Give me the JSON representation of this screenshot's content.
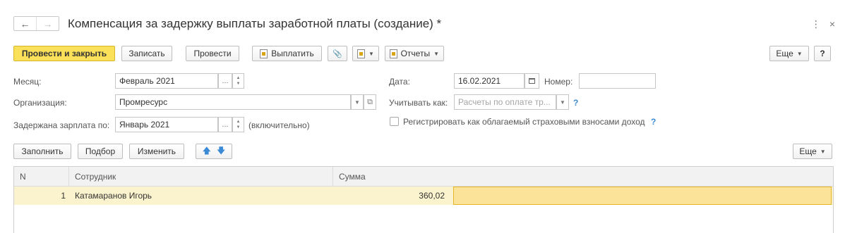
{
  "window": {
    "title": "Компенсация за задержку выплаты заработной платы (создание) *",
    "back_icon": "←",
    "forward_icon": "→",
    "more_icon": "⋮",
    "close_icon": "×"
  },
  "toolbar": {
    "post_close": "Провести и закрыть",
    "save": "Записать",
    "post": "Провести",
    "pay": "Выплатить",
    "attach_icon": "📎",
    "reports": "Отчеты",
    "more": "Еще",
    "help": "?"
  },
  "form": {
    "month_label": "Месяц:",
    "month_value": "Февраль 2021",
    "org_label": "Организация:",
    "org_value": "Промресурс",
    "delayed_label": "Задержана зарплата по:",
    "delayed_value": "Январь 2021",
    "inclusive_note": "(включительно)",
    "date_label": "Дата:",
    "date_value": "16.02.2021",
    "number_label": "Номер:",
    "number_value": "",
    "account_as_label": "Учитывать как:",
    "account_as_placeholder": "Расчеты по оплате тр...",
    "help_mark": "?",
    "register_checkbox_label": "Регистрировать как облагаемый страховыми взносами доход",
    "register_checked": false,
    "ellipsis": "...",
    "link_icon": "⧉"
  },
  "table_toolbar": {
    "fill": "Заполнить",
    "pick": "Подбор",
    "change": "Изменить",
    "up_icon": "🡅",
    "down_icon": "🡇",
    "more": "Еще"
  },
  "table": {
    "columns": [
      "N",
      "Сотрудник",
      "Сумма"
    ],
    "rows": [
      {
        "n": "1",
        "employee": "Катамаранов Игорь",
        "amount": "360,02"
      }
    ]
  },
  "colors": {
    "primary_button": "#fbe05a",
    "help_mark": "#3a8ad6",
    "selected_row": "#fbf3cd",
    "selected_cell": "#fbe49a"
  }
}
